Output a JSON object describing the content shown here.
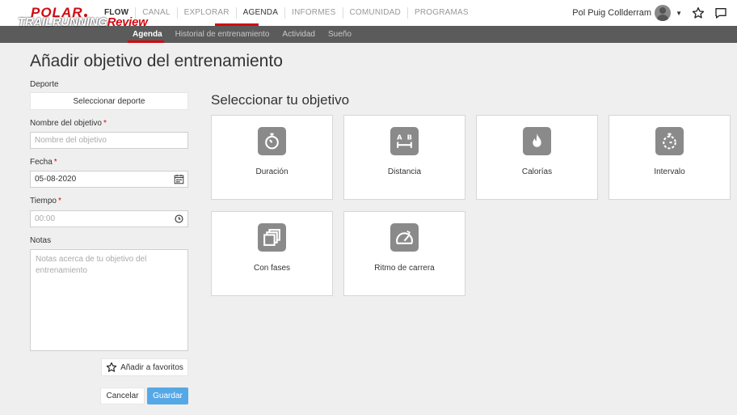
{
  "nav": {
    "logo": "POLAR",
    "items": [
      "FLOW",
      "CANAL",
      "EXPLORAR",
      "AGENDA",
      "INFORMES",
      "COMUNIDAD",
      "PROGRAMAS"
    ],
    "active": "AGENDA",
    "user_name": "Pol Puig Collderram"
  },
  "watermark": {
    "part1": "TRAILRUNNING",
    "part2": "Review"
  },
  "subnav": {
    "items": [
      "Agenda",
      "Historial de entrenamiento",
      "Actividad",
      "Sueño"
    ],
    "active": "Agenda"
  },
  "page": {
    "title": "Añadir objetivo del entrenamiento"
  },
  "form": {
    "sport_label": "Deporte",
    "sport_button": "Seleccionar deporte",
    "name_label": "Nombre del objetivo",
    "name_placeholder": "Nombre del objetivo",
    "date_label": "Fecha",
    "date_value": "05-08-2020",
    "time_label": "Tiempo",
    "time_placeholder": "00:00",
    "required_mark": "*",
    "notes_label": "Notas",
    "notes_placeholder": "Notas acerca de tu objetivo del entrenamiento",
    "favorites_button": "Añadir a favoritos",
    "cancel_button": "Cancelar",
    "save_button": "Guardar"
  },
  "goals": {
    "title": "Seleccionar tu objetivo",
    "cards": [
      {
        "label": "Duración",
        "icon": "stopwatch-icon"
      },
      {
        "label": "Distancia",
        "icon": "distance-ab-icon"
      },
      {
        "label": "Calorías",
        "icon": "flame-icon"
      },
      {
        "label": "Intervalo",
        "icon": "interval-timer-icon"
      },
      {
        "label": "Con fases",
        "icon": "phases-icon"
      },
      {
        "label": "Ritmo de carrera",
        "icon": "speedometer-icon"
      }
    ]
  },
  "colors": {
    "accent": "#d10a11",
    "primary_button": "#55a8e6",
    "subnav_bg": "#5b5b5b",
    "icon_tile": "#8a8a8a"
  }
}
